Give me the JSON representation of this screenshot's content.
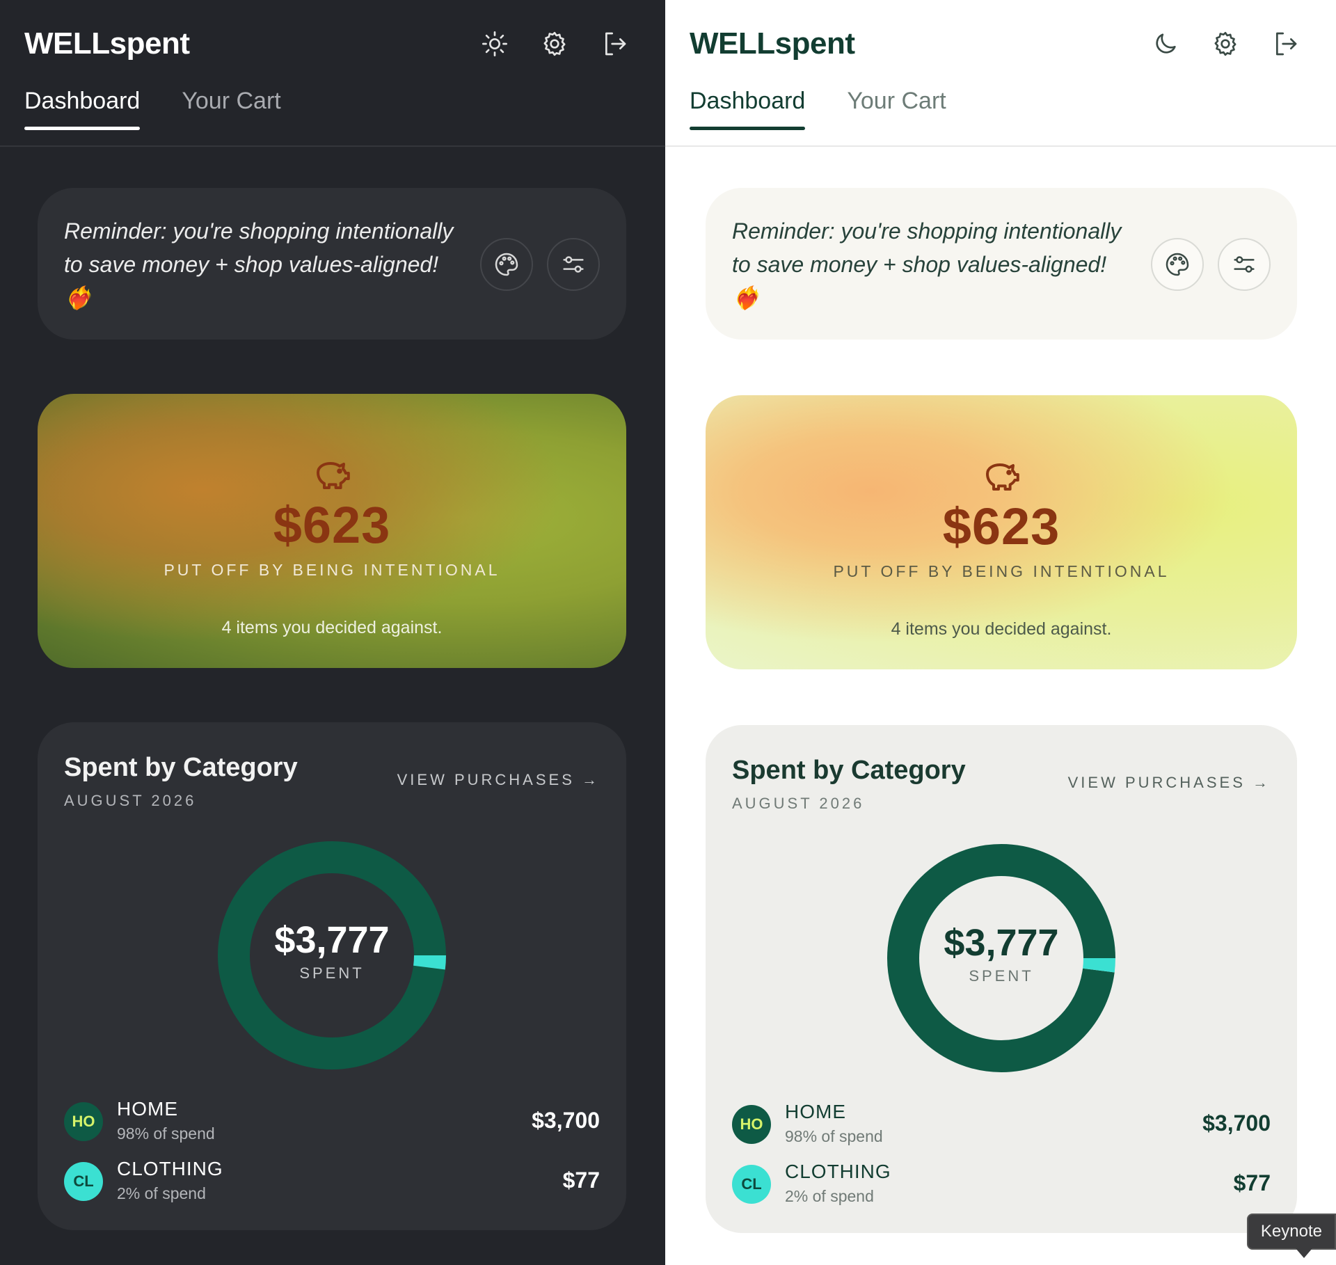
{
  "app": {
    "title": "WELLspent"
  },
  "tabs": [
    {
      "label": "Dashboard"
    },
    {
      "label": "Your Cart"
    }
  ],
  "reminder": {
    "text": "Reminder: you're shopping intentionally to save money + shop values-aligned! ❤️‍🔥"
  },
  "savings": {
    "amount": "$623",
    "caption": "PUT OFF BY BEING INTENTIONAL",
    "subtext": "4 items you decided against."
  },
  "category": {
    "title": "Spent by Category",
    "month": "AUGUST 2026",
    "view_link": "VIEW PURCHASES →",
    "total": "$3,777",
    "total_label": "SPENT",
    "items": [
      {
        "initials": "HO",
        "name": "HOME",
        "pct_text": "98% of spend",
        "value": "$3,700",
        "share": 0.98,
        "color": "#0e5a45"
      },
      {
        "initials": "CL",
        "name": "CLOTHING",
        "pct_text": "2% of spend",
        "value": "$77",
        "share": 0.02,
        "color": "#3be0d2"
      }
    ]
  },
  "icons": {
    "dark_theme_toggle": "sun-icon",
    "light_theme_toggle": "moon-icon",
    "settings": "gear-icon",
    "logout": "logout-icon",
    "palette": "palette-icon",
    "filters": "sliders-icon",
    "savings": "piggy-bank-icon"
  },
  "colors": {
    "brand_dark": "#123d31",
    "home": "#0e5a45",
    "clothing": "#3be0d2",
    "savings_amount": "#8a3512"
  },
  "tooltip": {
    "label": "Keynote"
  }
}
